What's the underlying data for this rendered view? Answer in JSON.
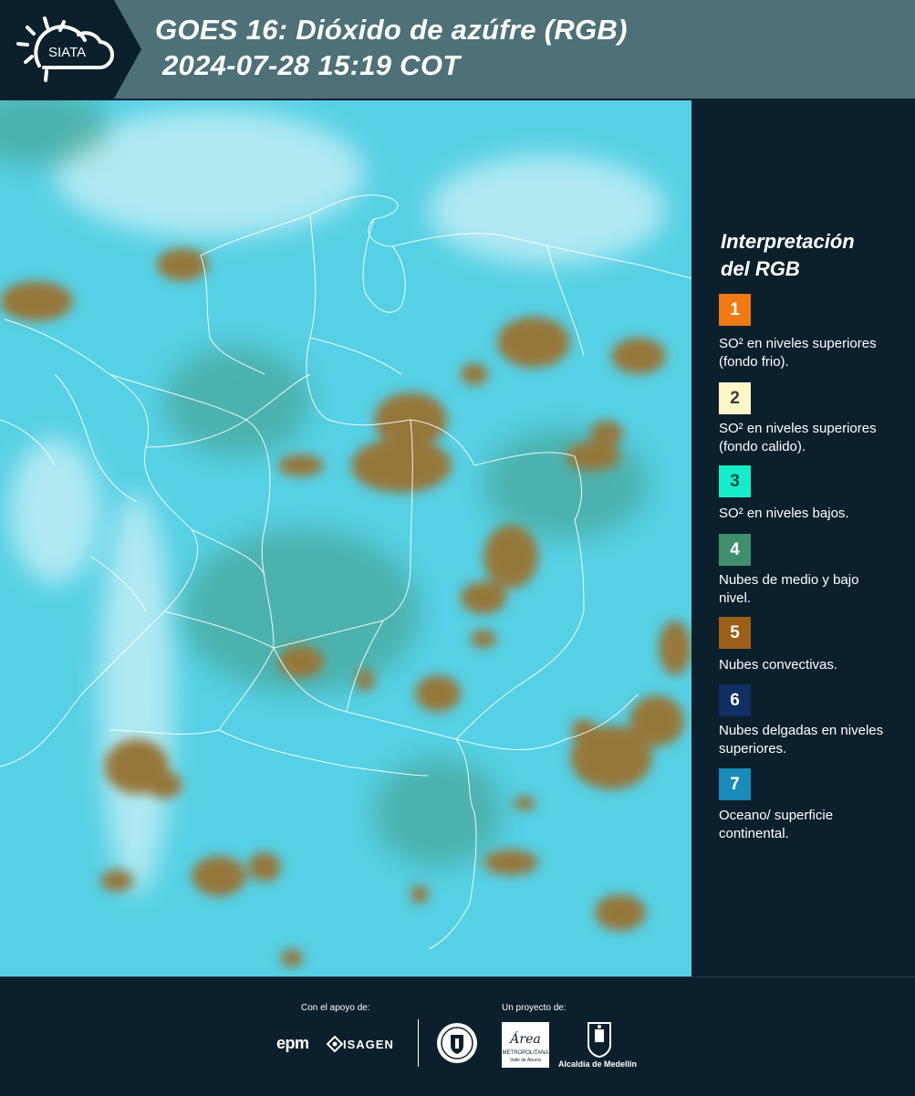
{
  "header": {
    "logo_text": "SIATA",
    "title_line1": "GOES 16: Dióxido de azúfre (RGB)",
    "title_line2": "2024-07-28 15:19 COT"
  },
  "legend": {
    "title_line1": "Interpretación",
    "title_line2": "del RGB",
    "items": [
      {
        "number": "1",
        "color": "#f07b14",
        "text": "SO² en niveles superiores (fondo frio)."
      },
      {
        "number": "2",
        "color": "#fdf7c8",
        "text": "SO² en niveles superiores (fondo calido)."
      },
      {
        "number": "3",
        "color": "#15ecc9",
        "text": "SO² en niveles bajos."
      },
      {
        "number": "4",
        "color": "#3f8f6c",
        "text": "Nubes de medio y bajo nivel."
      },
      {
        "number": "5",
        "color": "#9b5f17",
        "text": "Nubes convectivas."
      },
      {
        "number": "6",
        "color": "#0f2f63",
        "text": "Nubes delgadas en niveles superiores."
      },
      {
        "number": "7",
        "color": "#1a8bb8",
        "text": "Oceano/ superficie continental."
      }
    ]
  },
  "footer": {
    "support_label": "Con el apoyo de:",
    "project_label": "Un proyecto de:",
    "sponsors": [
      "epm",
      "ISAGEN"
    ],
    "area_word": "Área",
    "area_sub1": "METROPOLITANA",
    "area_sub2": "Valle de Aburrá",
    "alcaldia": "Alcaldía de Medellín"
  },
  "colors": {
    "header_bg": "#4e7079",
    "panel_bg": "#0c1f2d",
    "map_base": "#56d0e4",
    "cloud_brown": "#96773a",
    "cloud_green": "#3f8f6c"
  }
}
